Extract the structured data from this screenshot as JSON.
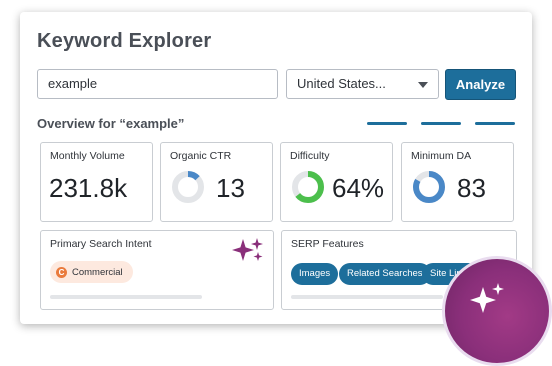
{
  "app": {
    "title": "Keyword Explorer"
  },
  "search": {
    "value": "example",
    "country": "United States...",
    "analyze_label": "Analyze"
  },
  "overview": {
    "heading": "Overview for “example”"
  },
  "metrics": [
    {
      "label": "Monthly Volume",
      "value": "231.8k"
    },
    {
      "label": "Organic CTR",
      "value": "13",
      "donut_fraction": 0.13,
      "donut_color": "#4a88c7"
    },
    {
      "label": "Difficulty",
      "value": "64%",
      "donut_fraction": 0.64,
      "donut_color": "#4cbf4c"
    },
    {
      "label": "Minimum DA",
      "value": "83",
      "donut_fraction": 0.83,
      "donut_color": "#4a88c7"
    }
  ],
  "intent": {
    "label": "Primary Search Intent",
    "badge_label": "Commercial",
    "badge_icon": "C"
  },
  "serp": {
    "label": "SERP Features",
    "pills": [
      "Images",
      "Related Searches",
      "Site Links"
    ]
  },
  "colors": {
    "accent": "#1d6e9b",
    "fab": "#8a2f7a",
    "sparkle": "#8a2f7a"
  },
  "icons": {
    "intent_decor": "sparkle-icon",
    "fab": "sparkle-icon"
  }
}
